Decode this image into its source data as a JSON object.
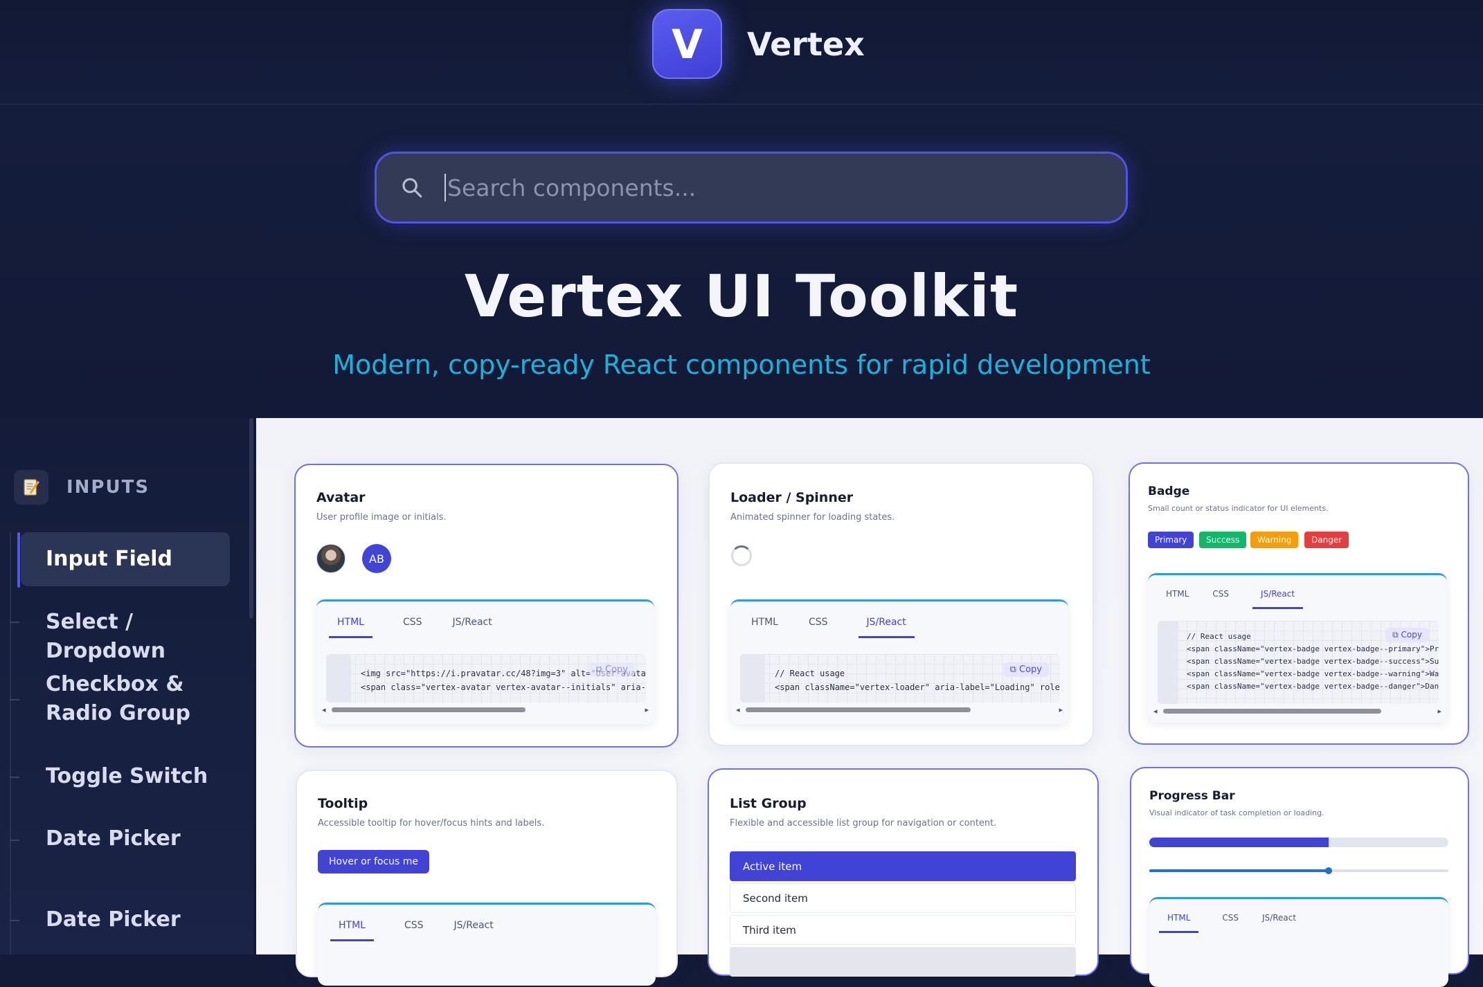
{
  "brand": {
    "logo_letter": "V",
    "name": "Vertex"
  },
  "search": {
    "placeholder": "Search components..."
  },
  "hero": {
    "title": "Vertex UI Toolkit",
    "subtitle": "Modern, copy-ready React components for rapid development"
  },
  "sidebar": {
    "section": {
      "label": "INPUTS",
      "icon": "memo-icon"
    },
    "items": [
      {
        "label": "Input Field",
        "active": true
      },
      {
        "label": "Select / Dropdown"
      },
      {
        "label": "Checkbox & Radio Group"
      },
      {
        "label": "Toggle Switch"
      },
      {
        "label": "Date Picker"
      },
      {
        "label": "Date Picker"
      }
    ]
  },
  "tab_labels": [
    "HTML",
    "CSS",
    "JS/React"
  ],
  "copy_label": "Copy",
  "cards": {
    "avatar": {
      "title": "Avatar",
      "desc": "User profile image or initials.",
      "initials": "AB",
      "active_tab": "HTML",
      "code": [
        "<img src=\"https://i.pravatar.cc/48?img=3\" alt=\"User avatar\"",
        "<span class=\"vertex-avatar vertex-avatar--initials\" aria-"
      ]
    },
    "loader": {
      "title": "Loader / Spinner",
      "desc": "Animated spinner for loading states.",
      "active_tab": "JS/React",
      "code": [
        "// React usage",
        "<span className=\"vertex-loader\" aria-label=\"Loading\" role"
      ]
    },
    "badge": {
      "title": "Badge",
      "desc": "Small count or status indicator for UI elements.",
      "badges": [
        {
          "label": "Primary",
          "color": "#4143d6"
        },
        {
          "label": "Success",
          "color": "#12b76a"
        },
        {
          "label": "Warning",
          "color": "#f59e0b"
        },
        {
          "label": "Danger",
          "color": "#e53e3e"
        }
      ],
      "active_tab": "JS/React",
      "code": [
        "// React usage",
        "<span className=\"vertex-badge vertex-badge--primary\">Prim",
        "<span className=\"vertex-badge vertex-badge--success\">Succ",
        "<span className=\"vertex-badge vertex-badge--warning\">Warn",
        "<span className=\"vertex-badge vertex-badge--danger\">Dange"
      ]
    },
    "tooltip": {
      "title": "Tooltip",
      "desc": "Accessible tooltip for hover/focus hints and labels.",
      "button": "Hover or focus me",
      "active_tab": "HTML"
    },
    "list_group": {
      "title": "List Group",
      "desc": "Flexible and accessible list group for navigation or content.",
      "items": [
        "Active item",
        "Second item",
        "Third item"
      ]
    },
    "progress": {
      "title": "Progress Bar",
      "desc": "Visual indicator of task completion or loading.",
      "progress_value": 0.6,
      "slider_value": 0.6,
      "active_tab": "HTML"
    }
  }
}
